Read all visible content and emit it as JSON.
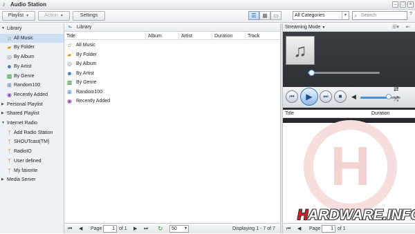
{
  "window": {
    "title": "Audio Station"
  },
  "toolbar": {
    "playlist_label": "Playlist",
    "action_label": "Action",
    "settings_label": "Settings",
    "category_value": "All Categories",
    "search_placeholder": "Search"
  },
  "sidebar": {
    "items": [
      {
        "label": "Library",
        "type": "head",
        "expanded": true,
        "icon": "triangle-down"
      },
      {
        "label": "All Music",
        "icon": "music-note-icon",
        "selected": true
      },
      {
        "label": "By Folder",
        "icon": "folder-icon"
      },
      {
        "label": "By Album",
        "icon": "album-icon"
      },
      {
        "label": "By Artist",
        "icon": "artist-icon"
      },
      {
        "label": "By Genre",
        "icon": "genre-icon"
      },
      {
        "label": "Random100",
        "icon": "random-icon"
      },
      {
        "label": "Recently Added",
        "icon": "recent-icon"
      },
      {
        "label": "Personal Playlist",
        "type": "head",
        "expanded": false
      },
      {
        "label": "Shared Playlist",
        "type": "head",
        "expanded": false
      },
      {
        "label": "Internet Radio",
        "type": "head",
        "expanded": true
      },
      {
        "label": "Add Radio Station",
        "icon": "radio-tower-icon"
      },
      {
        "label": "SHOUTcast(TM)",
        "icon": "radio-tower-icon"
      },
      {
        "label": "RadioIO",
        "icon": "radio-tower-icon"
      },
      {
        "label": "User defined",
        "icon": "radio-tower-icon"
      },
      {
        "label": "My favorite",
        "icon": "radio-tower-icon"
      },
      {
        "label": "Media Server",
        "type": "head",
        "expanded": false
      }
    ]
  },
  "main": {
    "breadcrumb": "Library",
    "columns": [
      "Title",
      "Album",
      "Artist",
      "Duration",
      "Track"
    ],
    "rows": [
      {
        "title": "All Music",
        "icon": "music-note-icon"
      },
      {
        "title": "By Folder",
        "icon": "folder-icon"
      },
      {
        "title": "By Album",
        "icon": "album-icon"
      },
      {
        "title": "By Artist",
        "icon": "artist-icon"
      },
      {
        "title": "By Genre",
        "icon": "genre-icon"
      },
      {
        "title": "Random100",
        "icon": "random-icon"
      },
      {
        "title": "Recently Added",
        "icon": "recent-icon"
      }
    ],
    "footer": {
      "page_label": "Page",
      "page_value": "1",
      "of_label": "of 1",
      "page_size": "50",
      "displaying": "Displaying 1 - 7 of 7"
    }
  },
  "player": {
    "mode_label": "Streaming Mode",
    "columns": [
      "Title",
      "Duration"
    ],
    "seek_progress": 0.05,
    "volume_level": 0.7,
    "footer": {
      "page_label": "Page",
      "page_value": "1",
      "of_label": "of 1"
    }
  },
  "watermark": {
    "brand": "HARDWARE.INFO"
  },
  "colors": {
    "accent": "#4d8fd6",
    "selection": "#cfdff3",
    "player_dark": "#2e3135"
  }
}
